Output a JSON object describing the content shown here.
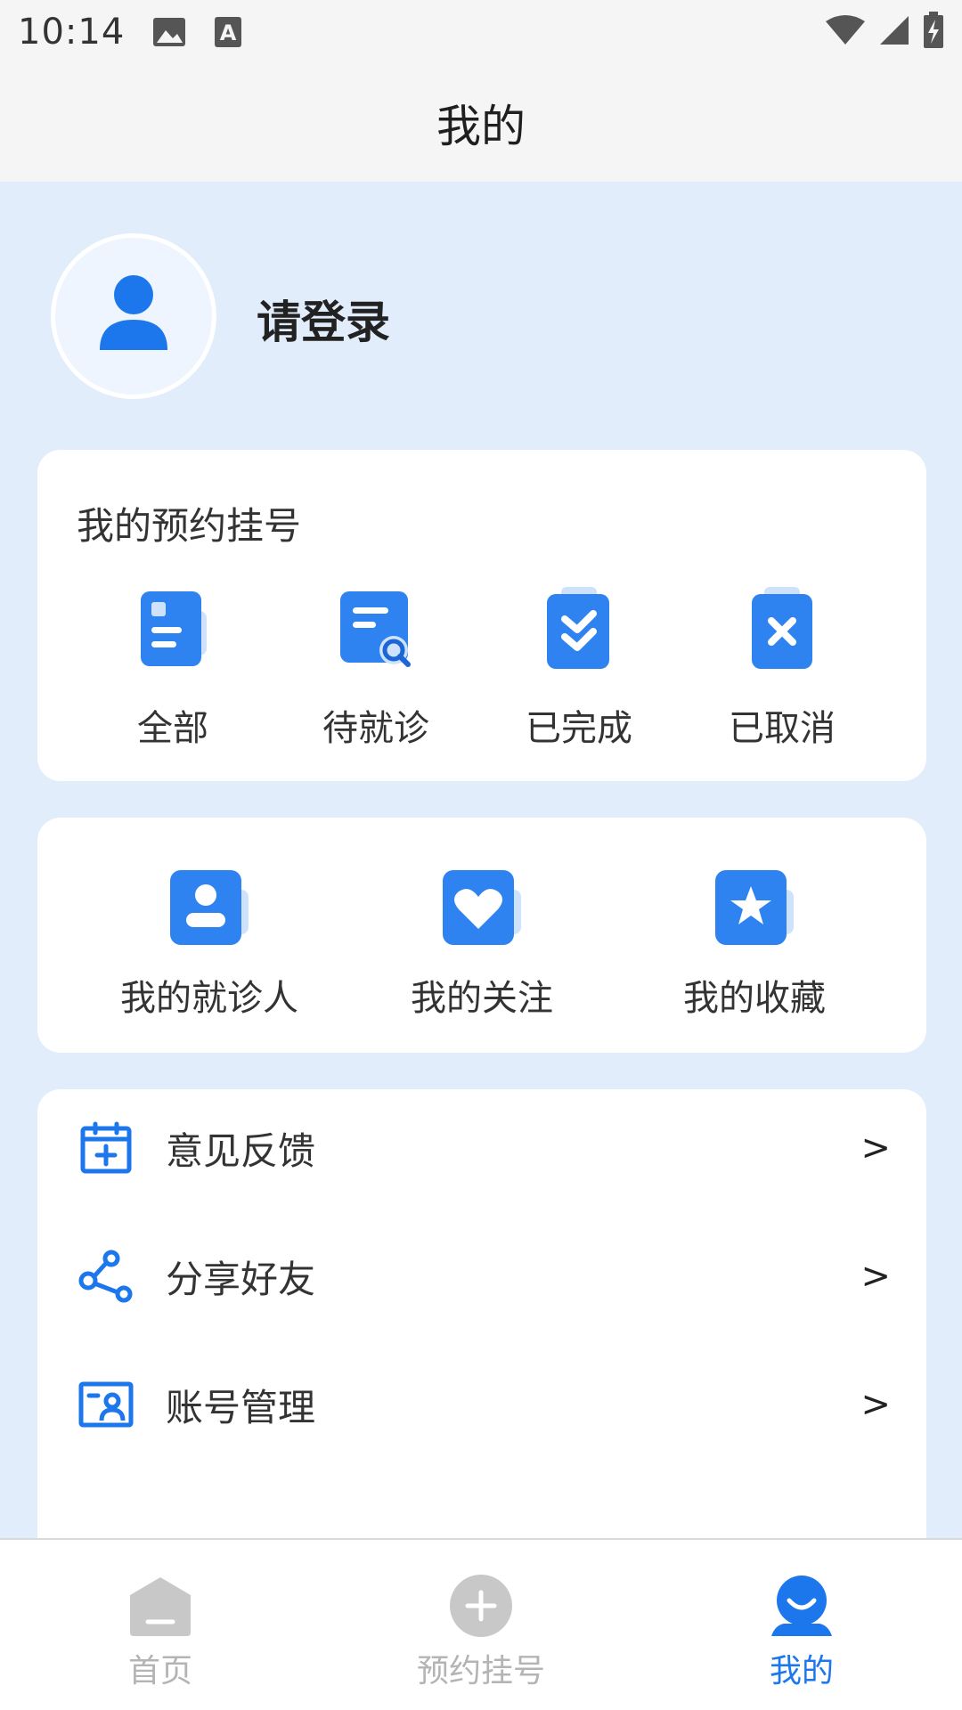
{
  "status_bar": {
    "time": "10:14",
    "icons": [
      "image-icon",
      "keyboard-a-icon",
      "wifi-icon",
      "signal-icon",
      "battery-charging-icon"
    ]
  },
  "header": {
    "title": "我的"
  },
  "profile": {
    "login_prompt": "请登录",
    "avatar_icon": "user-icon"
  },
  "appointments": {
    "title": "我的预约挂号",
    "items": [
      {
        "label": "全部",
        "icon": "document-list-icon"
      },
      {
        "label": "待就诊",
        "icon": "document-search-icon"
      },
      {
        "label": "已完成",
        "icon": "clipboard-check-icon"
      },
      {
        "label": "已取消",
        "icon": "clipboard-cancel-icon"
      }
    ]
  },
  "quick_links": {
    "items": [
      {
        "label": "我的就诊人",
        "icon": "patient-icon"
      },
      {
        "label": "我的关注",
        "icon": "heart-icon"
      },
      {
        "label": "我的收藏",
        "icon": "star-icon"
      }
    ]
  },
  "menu": {
    "items": [
      {
        "label": "意见反馈",
        "arrow": ">",
        "icon": "calendar-plus-icon"
      },
      {
        "label": "分享好友",
        "arrow": ">",
        "icon": "share-icon"
      },
      {
        "label": "账号管理",
        "arrow": ">",
        "icon": "account-card-icon"
      }
    ]
  },
  "bottom_nav": {
    "items": [
      {
        "label": "首页",
        "icon": "home-icon",
        "active": false
      },
      {
        "label": "预约挂号",
        "icon": "plus-circle-icon",
        "active": false
      },
      {
        "label": "我的",
        "icon": "user-smile-icon",
        "active": true
      }
    ]
  },
  "colors": {
    "accent": "#1c77ec",
    "page_background": "#e2edfc",
    "card_background": "#ffffff",
    "inactive_nav": "#b4b4b4"
  }
}
